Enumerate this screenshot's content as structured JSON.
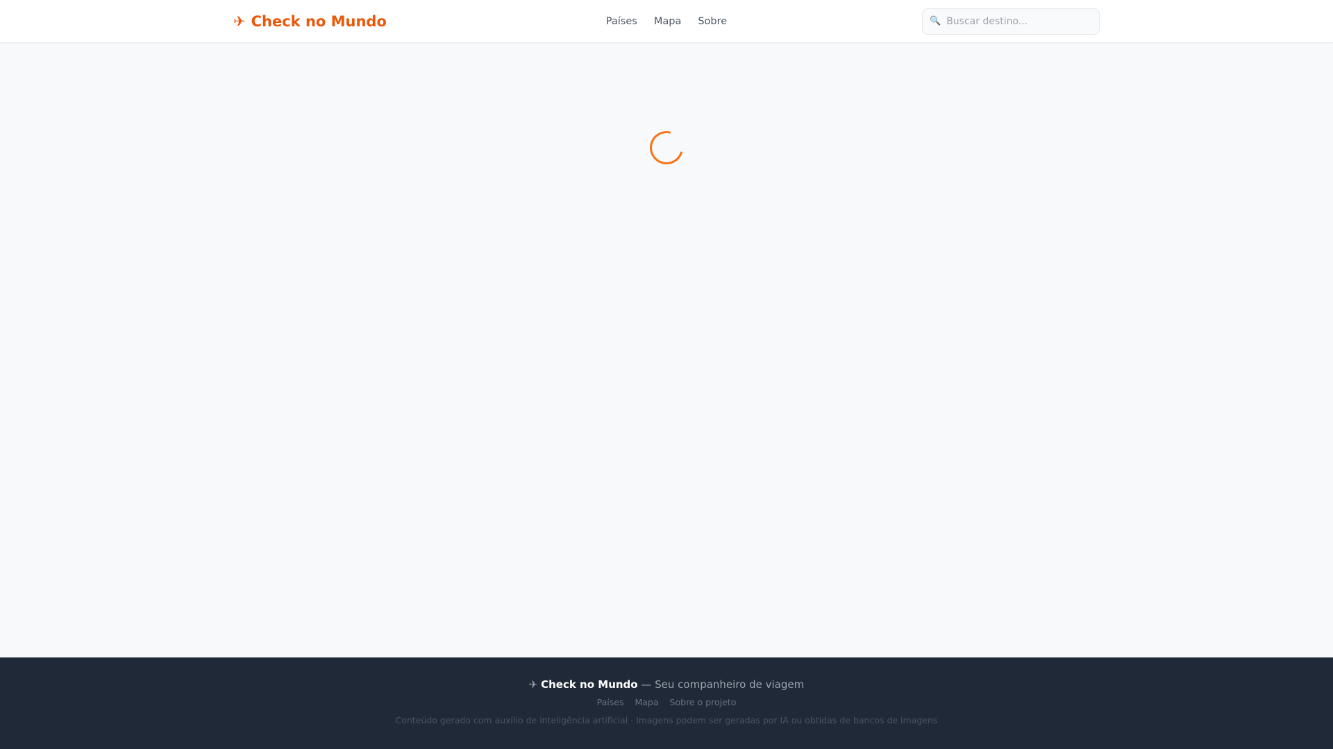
{
  "header": {
    "logo_icon": "✈",
    "logo": "Check no Mundo",
    "nav": [
      "Países",
      "Mapa",
      "Sobre"
    ],
    "search_placeholder": "Buscar destino...",
    "search_icon": "🔍"
  },
  "main": {
    "loading": true
  },
  "footer": {
    "icon": "✈",
    "brand": "Check no Mundo",
    "tagline": "— Seu companheiro de viagem",
    "links": [
      "Países",
      "Mapa",
      "Sobre o projeto"
    ],
    "disclaimer": "Conteúdo gerado com auxílio de inteligência artificial · Imagens podem ser geradas por IA ou obtidas de bancos de imagens"
  },
  "colors": {
    "accent": "#ea580c",
    "footer_bg": "#1f2937"
  }
}
